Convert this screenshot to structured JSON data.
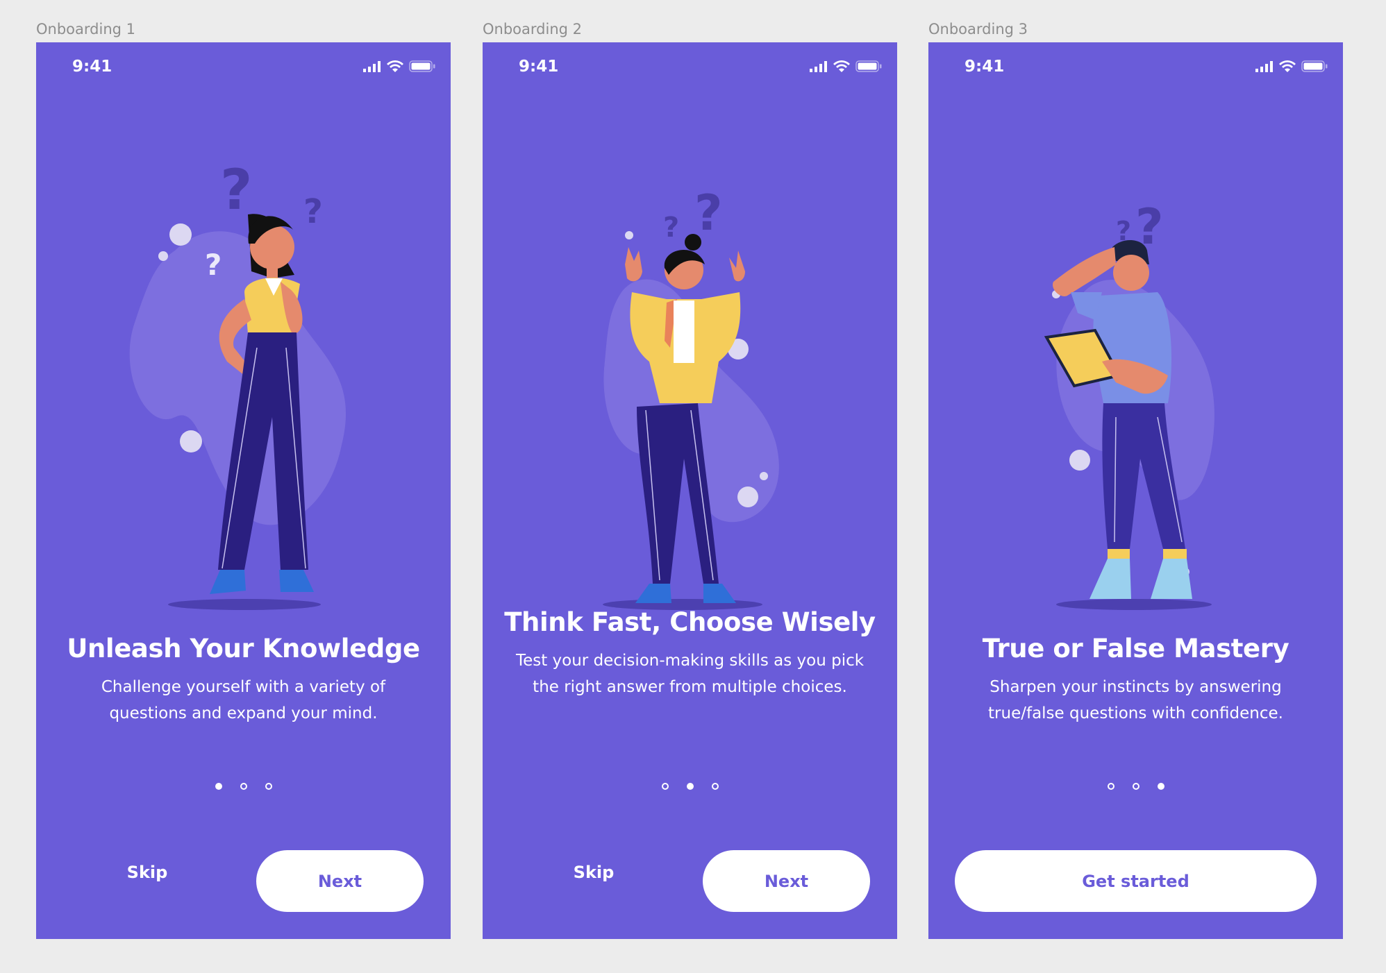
{
  "screens": [
    {
      "frame_label": "Onboarding 1",
      "status_time": "9:41",
      "title": "Unleash Your Knowledge",
      "description": "Challenge yourself with a variety of questions and expand your mind.",
      "active_dot": 0,
      "skip_label": "Skip",
      "primary_label": "Next"
    },
    {
      "frame_label": "Onboarding 2",
      "status_time": "9:41",
      "title": "Think Fast, Choose Wisely",
      "description": "Test your decision-making skills as you pick the right answer from multiple choices.",
      "active_dot": 1,
      "skip_label": "Skip",
      "primary_label": "Next"
    },
    {
      "frame_label": "Onboarding 3",
      "status_time": "9:41",
      "title": "True or False Mastery",
      "description": "Sharpen your instincts by answering true/false questions with confidence.",
      "active_dot": 2,
      "primary_label": "Get started"
    }
  ],
  "icons": [
    "signal-icon",
    "wifi-icon",
    "battery-icon"
  ],
  "colors": {
    "background": "#ececec",
    "screen": "#6a5cd9",
    "button": "#ffffff",
    "button_text": "#6a5cd9",
    "pants": "#2a1f80",
    "shirt_yellow": "#f5cd5a",
    "skin": "#e58a6d",
    "hair": "#111111"
  }
}
